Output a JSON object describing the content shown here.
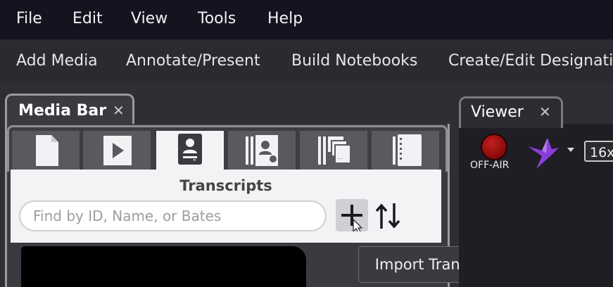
{
  "menu": {
    "file": "File",
    "edit": "Edit",
    "view": "View",
    "tools": "Tools",
    "help": "Help"
  },
  "toolbar": {
    "add_media": "Add Media",
    "annotate_present": "Annotate/Present",
    "build_notebooks": "Build Notebooks",
    "create_edit": "Create/Edit Designati"
  },
  "media_bar": {
    "tab_label": "Media Bar",
    "close_glyph": "✕",
    "icon_tabs": [
      {
        "name": "documents-icon",
        "active": false
      },
      {
        "name": "video-play-icon",
        "active": false
      },
      {
        "name": "transcript-icon",
        "active": true
      },
      {
        "name": "witness-deposition-icon",
        "active": false
      },
      {
        "name": "exhibits-stack-icon",
        "active": false
      },
      {
        "name": "notebook-icon",
        "active": false
      }
    ],
    "section_title": "Transcripts",
    "search_placeholder": "Find by ID, Name, or Bates",
    "add_icon": "plus-icon",
    "sort_icon": "sort-up-down-icon",
    "tooltip": "Import Transcripts"
  },
  "viewer": {
    "tab_label": "Viewer",
    "close_glyph": "✕",
    "onair_label": "OFF-AIR",
    "aspect_label": "16x"
  },
  "colors": {
    "menubar_bg": "#151320",
    "active_tab_bg": "#f4f4f6",
    "bird_purple": "#8a3ed8",
    "offair_red": "#c42020"
  }
}
